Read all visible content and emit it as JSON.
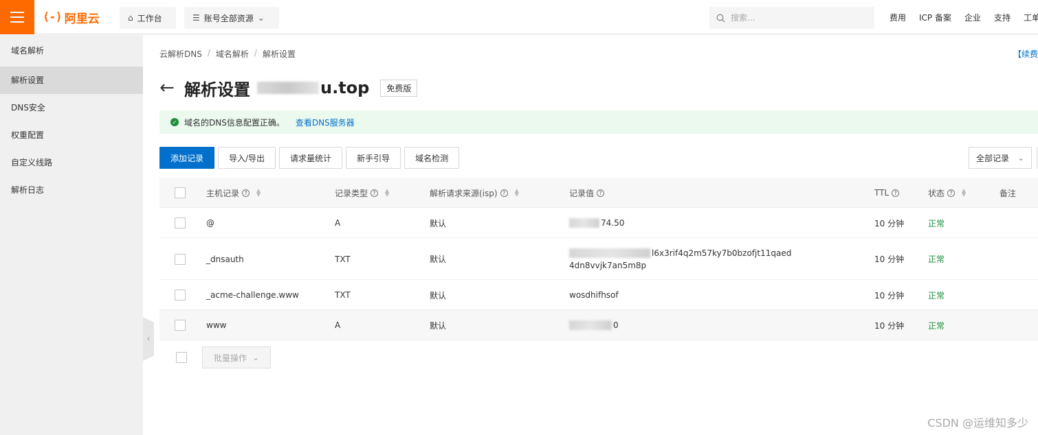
{
  "topbar": {
    "logo_mark": "(-)",
    "logo_text": "阿里云",
    "workbench": "工作台",
    "resources": "账号全部资源",
    "search_placeholder": "搜索...",
    "links": [
      "费用",
      "ICP 备案",
      "企业",
      "支持",
      "工单"
    ]
  },
  "sidebar": {
    "title": "域名解析",
    "items": [
      "解析设置",
      "DNS安全",
      "权重配置",
      "自定义线路",
      "解析日志"
    ]
  },
  "breadcrumb": [
    "云解析DNS",
    "域名解析",
    "解析设置"
  ],
  "renew_link": "【续费",
  "page": {
    "title": "解析设置",
    "domain_suffix": "u.top",
    "edition": "免费版"
  },
  "alert": {
    "message": "域名的DNS信息配置正确。",
    "link": "查看DNS服务器"
  },
  "toolbar": {
    "add": "添加记录",
    "import_export": "导入/导出",
    "stats": "请求量统计",
    "guide": "新手引导",
    "check": "域名检测",
    "filter": "全部记录"
  },
  "table": {
    "headers": {
      "host": "主机记录",
      "type": "记录类型",
      "isp": "解析请求来源(isp)",
      "value": "记录值",
      "ttl": "TTL",
      "status": "状态",
      "note": "备注"
    },
    "rows": [
      {
        "host": "@",
        "type": "A",
        "isp": "默认",
        "value_visible": "74.50",
        "value_line2": "",
        "ttl": "10 分钟",
        "status": "正常"
      },
      {
        "host": "_dnsauth",
        "type": "TXT",
        "isp": "默认",
        "value_visible": "l6x3rif4q2m57ky7b0bzofjt11qaed",
        "value_line2": "4dn8vvjk7an5m8p",
        "ttl": "10 分钟",
        "status": "正常"
      },
      {
        "host": "_acme-challenge.www",
        "type": "TXT",
        "isp": "默认",
        "value_visible": "wosdhifhsof",
        "value_line2": "",
        "ttl": "10 分钟",
        "status": "正常"
      },
      {
        "host": "www",
        "type": "A",
        "isp": "默认",
        "value_visible": "0",
        "value_line2": "",
        "ttl": "10 分钟",
        "status": "正常"
      }
    ]
  },
  "batch": "批量操作",
  "watermark": "CSDN @运维知多少",
  "colors": {
    "brand": "#ff6a00",
    "primary": "#0070cc",
    "success": "#1e8e3e"
  }
}
